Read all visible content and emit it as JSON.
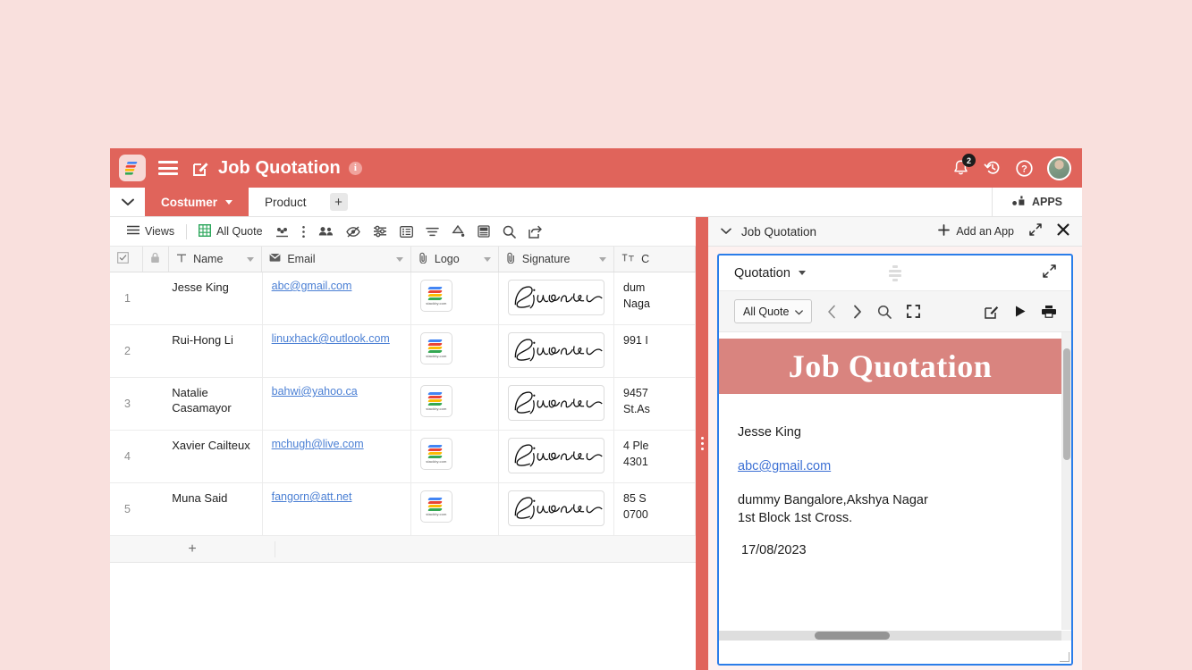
{
  "header": {
    "app_title": "Job Quotation",
    "info_icon": "info-icon",
    "brand_logo": "stackby-logo",
    "menu_icon": "hamburger-menu-icon",
    "edit_icon": "edit-title-icon",
    "notification_count": "2",
    "history_icon": "history-icon",
    "help_icon": "help-icon",
    "avatar": "user-avatar"
  },
  "tabs": {
    "collapse_icon": "chevron-down-icon",
    "items": [
      {
        "label": "Costumer",
        "active": true
      },
      {
        "label": "Product",
        "active": false
      }
    ],
    "add_label": "+",
    "apps_label": "APPS"
  },
  "grid_toolbar": {
    "views_label": "Views",
    "view_name": "All Quote",
    "icons": [
      "views-list-icon",
      "grid-view-icon",
      "group-people-icon",
      "more-vertical-icon",
      "collaborators-icon",
      "hide-fields-icon",
      "filter-settings-icon",
      "row-height-icon",
      "sort-icon",
      "color-fill-icon",
      "card-layout-icon",
      "search-icon",
      "share-export-icon"
    ]
  },
  "grid": {
    "columns": [
      {
        "key": "rownum",
        "label": "",
        "icon": "checkbox-icon"
      },
      {
        "key": "lock",
        "label": "",
        "icon": "lock-icon"
      },
      {
        "key": "name",
        "label": "Name",
        "icon": "text-field-icon"
      },
      {
        "key": "email",
        "label": "Email",
        "icon": "email-icon"
      },
      {
        "key": "logo",
        "label": "Logo",
        "icon": "attachment-icon"
      },
      {
        "key": "signature",
        "label": "Signature",
        "icon": "attachment-icon"
      },
      {
        "key": "address",
        "label": "C",
        "icon": "long-text-icon"
      }
    ],
    "rows": [
      {
        "num": "1",
        "name": "Jesse King",
        "email": "abc@gmail.com",
        "logo": "stackby.com",
        "signature": "Signature",
        "address_l1": "dum",
        "address_l2": "Naga"
      },
      {
        "num": "2",
        "name": "Rui-Hong Li",
        "email": "linuxhack@outlook.com",
        "logo": "stackby.com",
        "signature": "Signature",
        "address_l1": "991 I",
        "address_l2": ""
      },
      {
        "num": "3",
        "name": "Natalie Casamayor",
        "email": "bahwi@yahoo.ca",
        "logo": "stackby.com",
        "signature": "Signature",
        "address_l1": "9457",
        "address_l2": "St.As"
      },
      {
        "num": "4",
        "name": "Xavier Cailteux",
        "email": "mchugh@live.com",
        "logo": "stackby.com",
        "signature": "Signature",
        "address_l1": "4 Ple",
        "address_l2": "4301"
      },
      {
        "num": "5",
        "name": "Muna Said",
        "email": "fangorn@att.net",
        "logo": "stackby.com",
        "signature": "Signature",
        "address_l1": "85 S",
        "address_l2": "0700"
      }
    ],
    "add_row_label": "+"
  },
  "right_panel": {
    "title": "Job Quotation",
    "collapse_icon": "chevron-down-icon",
    "add_app_label": "Add an App",
    "expand_icon": "expand-diagonal-icon",
    "close_icon": "close-icon"
  },
  "app_card": {
    "title": "Quotation",
    "drag_handle": "drag-grip-icon",
    "expand_icon": "expand-diagonal-icon",
    "select_value": "All Quote",
    "toolbar_icons": [
      "chevron-left-icon",
      "chevron-right-icon",
      "search-icon",
      "fullscreen-icon",
      "edit-square-icon",
      "play-icon",
      "print-icon"
    ]
  },
  "document": {
    "banner_title": "Job Quotation",
    "customer_name": "Jesse King",
    "customer_email": "abc@gmail.com",
    "address_line1": "dummy Bangalore,Akshya Nagar",
    "address_line2": "1st Block 1st Cross.",
    "date": "17/08/2023"
  },
  "colors": {
    "page_background": "#f9e0dd",
    "brand_red": "#e0645b",
    "doc_banner": "#d9847f",
    "link_blue": "#4a7fd4",
    "focus_blue": "#2b7de9"
  }
}
